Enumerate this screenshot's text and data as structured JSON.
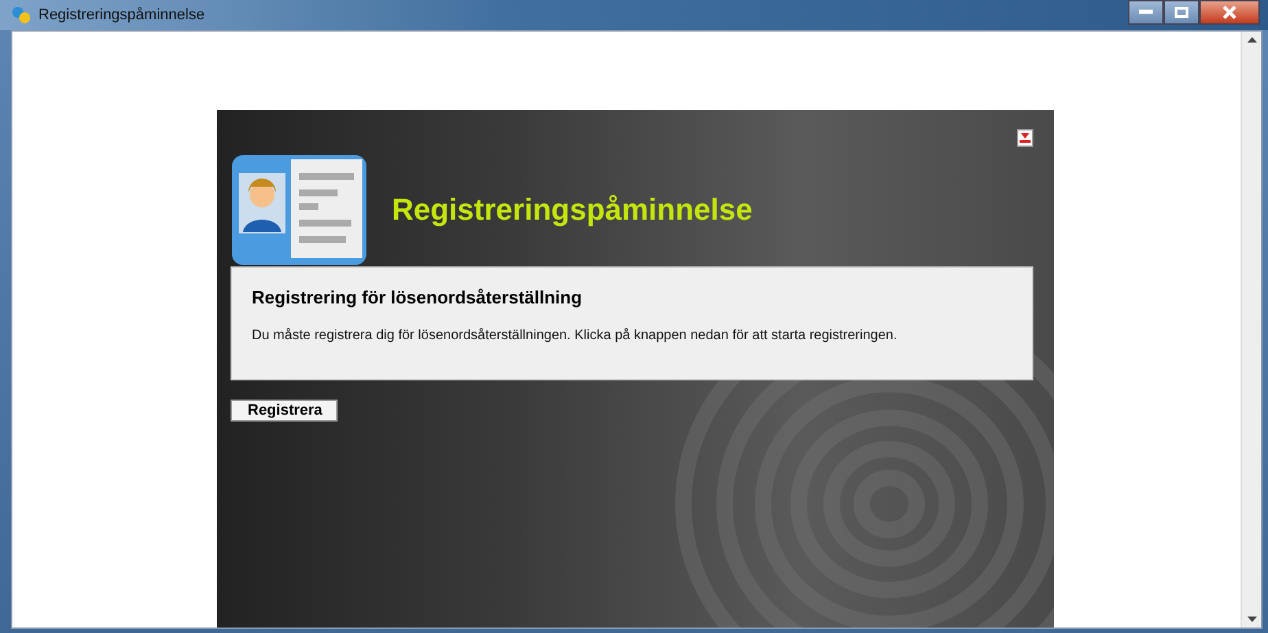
{
  "window": {
    "title": "Registreringspåminnelse"
  },
  "header": {
    "title": "Registreringspåminnelse"
  },
  "notice": {
    "heading": "Registrering för lösenordsåterställning",
    "body": "Du måste registrera dig för lösenordsåterställningen. Klicka på knappen nedan för att starta registreringen."
  },
  "buttons": [
    "Registrera"
  ]
}
